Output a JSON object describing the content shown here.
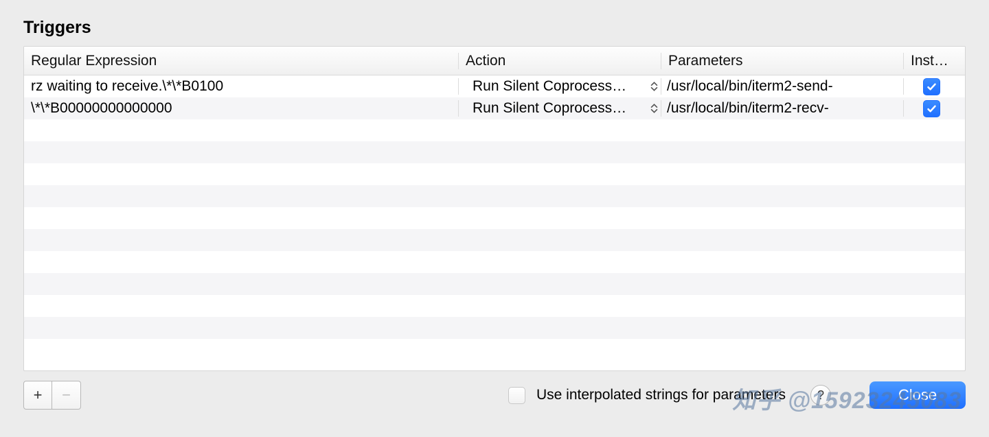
{
  "title": "Triggers",
  "columns": {
    "regex": "Regular Expression",
    "action": "Action",
    "parameters": "Parameters",
    "instant": "Instant"
  },
  "rows": [
    {
      "regex": "rz waiting to receive.\\*\\*B0100",
      "action": "Run Silent Coprocess…",
      "parameters": "/usr/local/bin/iterm2-send-",
      "instant": true
    },
    {
      "regex": "\\*\\*B00000000000000",
      "action": "Run Silent Coprocess…",
      "parameters": "/usr/local/bin/iterm2-recv-",
      "instant": true
    }
  ],
  "footer": {
    "add_label": "+",
    "remove_label": "−",
    "interpolated_label": "Use interpolated strings for parameters",
    "interpolated_checked": false,
    "help_label": "?",
    "close_label": "Close"
  },
  "watermark": "知乎 @15923245083",
  "colors": {
    "accent": "#1f6fff"
  }
}
